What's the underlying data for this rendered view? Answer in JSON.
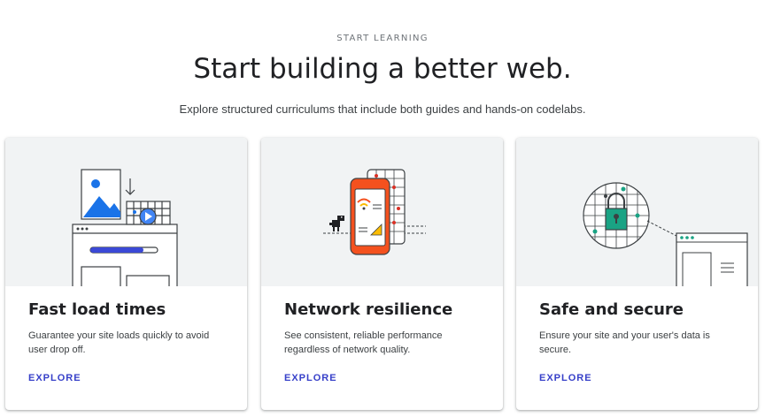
{
  "section": {
    "eyebrow": "START LEARNING",
    "title": "Start building a better web.",
    "subtitle": "Explore structured curriculums that include both guides and hands-on codelabs."
  },
  "cards": [
    {
      "title": "Fast load times",
      "description": "Guarantee your site loads quickly to avoid user drop off.",
      "link_label": "EXPLORE",
      "illustration": "page-load-illustration"
    },
    {
      "title": "Network resilience",
      "description": "See consistent, reliable performance regardless of network quality.",
      "link_label": "EXPLORE",
      "illustration": "offline-phone-dino-illustration"
    },
    {
      "title": "Safe and secure",
      "description": "Ensure your site and your user's data is secure.",
      "link_label": "EXPLORE",
      "illustration": "padlock-globe-illustration"
    }
  ],
  "colors": {
    "link": "#3740c9",
    "accent_blue": "#1a73e8",
    "accent_orange": "#f4511e",
    "accent_teal": "#1aa384",
    "accent_red": "#d93025",
    "art_background": "#f1f3f4"
  }
}
